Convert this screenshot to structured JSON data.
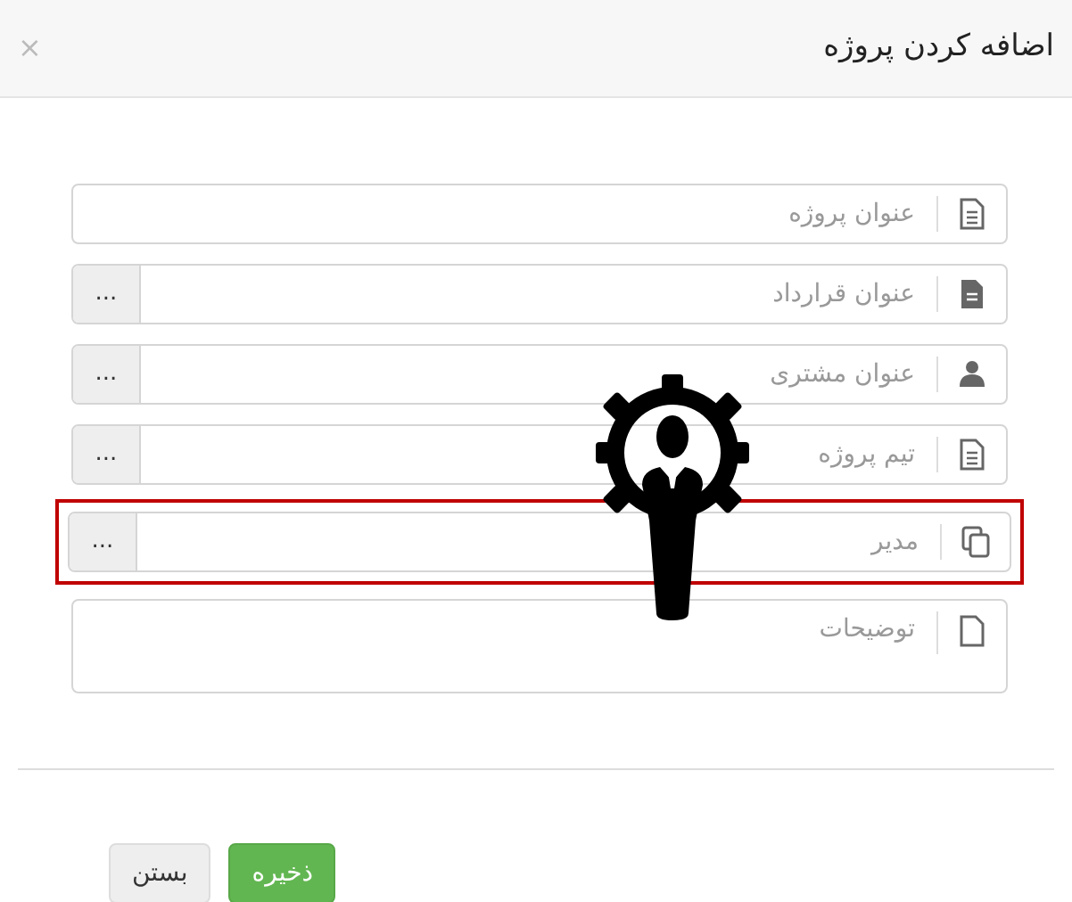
{
  "dialog": {
    "title": "اضافه کردن پروژه",
    "close": "×"
  },
  "fields": [
    {
      "kind": "plain",
      "placeholder": "عنوان پروژه",
      "highlighted": false
    },
    {
      "kind": "picker",
      "placeholder": "عنوان قرارداد",
      "button": "...",
      "highlighted": false
    },
    {
      "kind": "picker",
      "placeholder": "عنوان مشتری",
      "button": "...",
      "highlighted": false
    },
    {
      "kind": "picker",
      "placeholder": "تیم پروژه",
      "button": "...",
      "highlighted": false
    },
    {
      "kind": "picker",
      "placeholder": "مدیر",
      "button": "...",
      "highlighted": true
    },
    {
      "kind": "textarea",
      "placeholder": "توضیحات",
      "highlighted": false
    }
  ],
  "buttons": [
    {
      "kind": "primary",
      "label": "ذخیره"
    },
    {
      "kind": "default",
      "label": "بستن"
    }
  ]
}
